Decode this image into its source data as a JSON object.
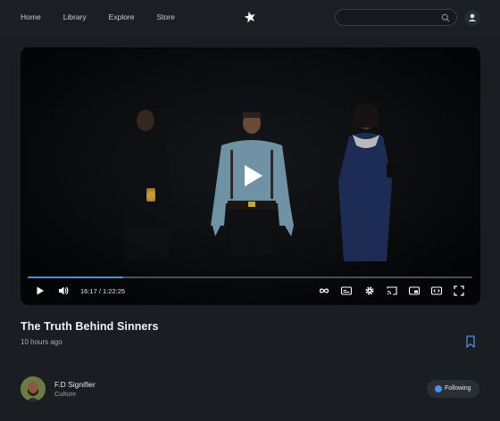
{
  "nav": {
    "items": [
      "Home",
      "Library",
      "Explore",
      "Store"
    ]
  },
  "search": {
    "placeholder": ""
  },
  "video": {
    "progress": 0.215,
    "current_time": "16:17",
    "duration": "1:22:25",
    "time_display": "16:17 / 1:22:25",
    "title": "The Truth Behind Sinners",
    "posted": "10 hours ago"
  },
  "channel": {
    "name": "F.D Signifier",
    "category": "Culture",
    "follow_label": "Following"
  },
  "colors": {
    "accent": "#4a90e2",
    "background": "#1a1e23"
  },
  "icons": {
    "logo": "star-logo-icon",
    "search": "search-icon",
    "user": "user-icon",
    "play": "play-icon",
    "volume": "volume-icon",
    "loop": "loop-icon",
    "captions": "captions-icon",
    "settings": "gear-icon",
    "cast": "cast-icon",
    "miniplayer": "miniplayer-icon",
    "embed": "embed-icon",
    "fullscreen": "fullscreen-icon",
    "bookmark": "bookmark-icon"
  }
}
